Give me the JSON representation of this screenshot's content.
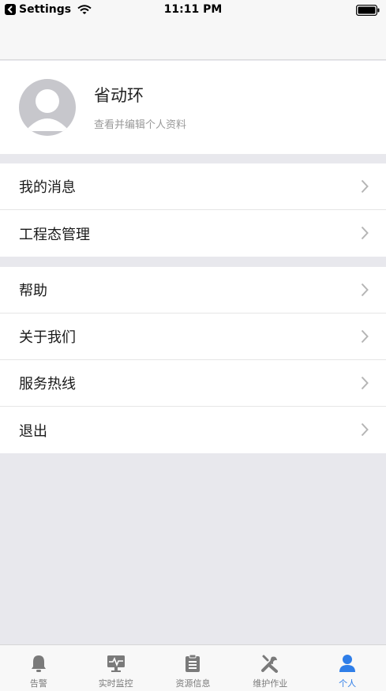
{
  "status_bar": {
    "back_app": "Settings",
    "time": "11:11 PM"
  },
  "profile": {
    "name": "省动环",
    "subtitle": "查看并编辑个人资料"
  },
  "menu_group_1": [
    {
      "label": "我的消息"
    },
    {
      "label": "工程态管理"
    }
  ],
  "menu_group_2": [
    {
      "label": "帮助"
    },
    {
      "label": "关于我们"
    },
    {
      "label": "服务热线"
    },
    {
      "label": "退出"
    }
  ],
  "tab_bar": {
    "tabs": [
      {
        "label": "告警",
        "icon": "bell-icon"
      },
      {
        "label": "实时监控",
        "icon": "monitor-icon"
      },
      {
        "label": "资源信息",
        "icon": "clipboard-icon"
      },
      {
        "label": "维护作业",
        "icon": "tools-icon"
      },
      {
        "label": "个人",
        "icon": "person-icon"
      }
    ],
    "active_index": 4
  },
  "colors": {
    "accent": "#2f7ee8",
    "inactive_icon": "#7a7a7a",
    "background": "#e8e8ed"
  }
}
